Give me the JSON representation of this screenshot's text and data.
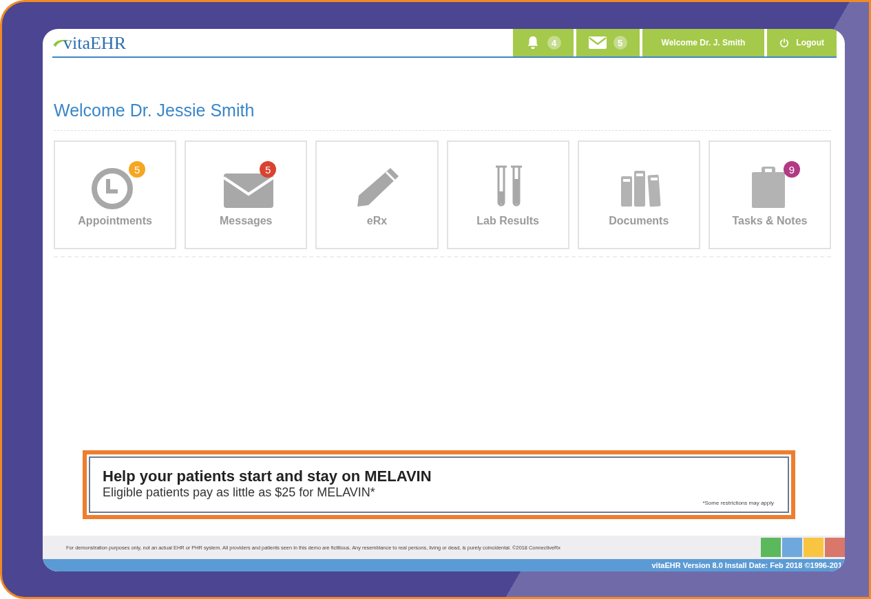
{
  "header": {
    "logo": "vitaEHR",
    "notifications": [
      {
        "kind": "bell",
        "count": "4"
      },
      {
        "kind": "mail",
        "count": "5"
      }
    ],
    "welcome": "Welcome Dr. J. Smith",
    "logout": "Logout"
  },
  "page_title": "Welcome Dr. Jessie Smith",
  "tiles": [
    {
      "kind": "clock",
      "label": "Appointments",
      "badge": "5",
      "color": "#f5a623"
    },
    {
      "kind": "mail",
      "label": "Messages",
      "badge": "5",
      "color": "#d9432f"
    },
    {
      "kind": "pencil",
      "label": "eRx"
    },
    {
      "kind": "tubes",
      "label": "Lab Results"
    },
    {
      "kind": "books",
      "label": "Documents"
    },
    {
      "kind": "clipboard",
      "label": "Tasks & Notes",
      "badge": "9",
      "color": "#b23a84"
    }
  ],
  "ad": {
    "headline": "Help your patients start and stay on MELAVIN",
    "body": "Eligible patients pay as little as $25 for MELAVIN*",
    "fine_print": "*Some restrictions may apply"
  },
  "footer": {
    "disclaimer": "For demonstration purposes only, not an actual EHR or PHR system. All providers and patients seen in this demo are fictitious. Any resemblance to real persons, living or dead, is purely coincidental. ©2018 ConnectiveRx",
    "swatches": [
      {
        "color": "#5cb85c"
      },
      {
        "color": "#6fa8dc"
      },
      {
        "color": "#f9c440"
      },
      {
        "color": "#d9776a"
      }
    ],
    "version": "vitaEHR Version 8.0 Install Date: Feb 2018 ©1996-201"
  }
}
